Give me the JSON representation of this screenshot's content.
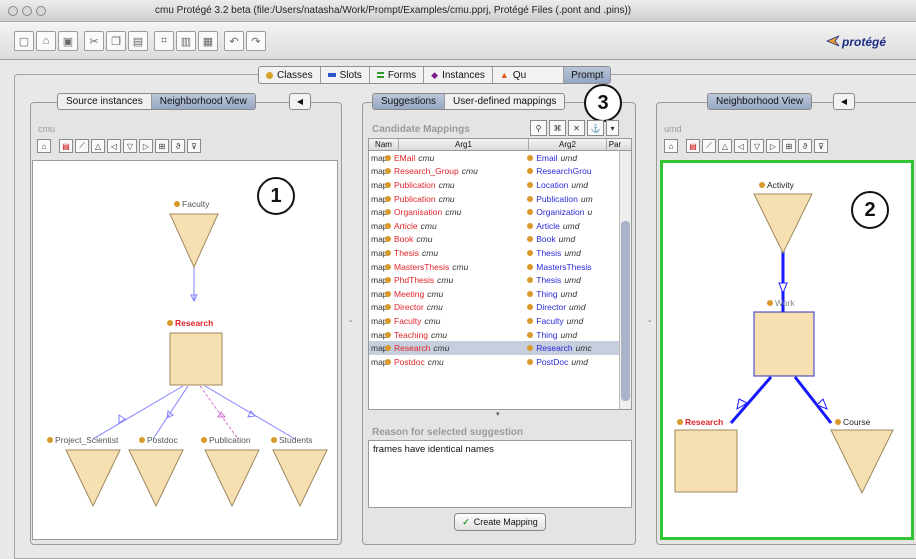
{
  "window": {
    "title": "cmu  Protégé 3.2 beta   (file:/Users/natasha/Work/Prompt/Examples/cmu.pprj, Protégé Files (.pont and .pins))"
  },
  "toolbar": {
    "logo": "protégé"
  },
  "main_tabs": [
    {
      "label": "Classes",
      "color": "#d9a22a"
    },
    {
      "label": "Slots",
      "color": "#2b55c8"
    },
    {
      "label": "Forms",
      "color": "#2e9a2e"
    },
    {
      "label": "Instances",
      "color": "#7a1e88"
    },
    {
      "label": "Qu",
      "color": "#e05a1a"
    },
    {
      "label": "Prompt",
      "color": ""
    }
  ],
  "left": {
    "tabs": [
      "Source instances",
      "Neighborhood View"
    ],
    "title": "cmu",
    "callout": "1",
    "nodes": {
      "root": "Faculty",
      "center": "Research",
      "children": [
        "Project_Scientist",
        "Postdoc",
        "Publication",
        "Students"
      ]
    }
  },
  "middle": {
    "tabs": [
      "Suggestions",
      "User-defined mappings"
    ],
    "callout": "3",
    "title": "Candidate Mappings",
    "columns": [
      "Nam",
      "Arg1",
      "Arg2",
      "Par"
    ],
    "rows": [
      {
        "a": "map",
        "s": "EMail",
        "so": "cmu",
        "t": "Email",
        "to": "umd"
      },
      {
        "a": "map",
        "s": "Research_Group",
        "so": "cmu",
        "t": "ResearchGrou",
        "to": ""
      },
      {
        "a": "map",
        "s": "Publication",
        "so": "cmu",
        "t": "Location",
        "to": "umd"
      },
      {
        "a": "map",
        "s": "Publication",
        "so": "cmu",
        "t": "Publication",
        "to": "um"
      },
      {
        "a": "map",
        "s": "Organisation",
        "so": "cmu",
        "t": "Organization",
        "to": "u"
      },
      {
        "a": "map",
        "s": "Article",
        "so": "cmu",
        "t": "Article",
        "to": "umd"
      },
      {
        "a": "map",
        "s": "Book",
        "so": "cmu",
        "t": "Book",
        "to": "umd"
      },
      {
        "a": "map",
        "s": "Thesis",
        "so": "cmu",
        "t": "Thesis",
        "to": "umd"
      },
      {
        "a": "map",
        "s": "MastersThesis",
        "so": "cmu",
        "t": "MastersThesis",
        "to": ""
      },
      {
        "a": "map",
        "s": "PhdThesis",
        "so": "cmu",
        "t": "Thesis",
        "to": "umd"
      },
      {
        "a": "map",
        "s": "Meeting",
        "so": "cmu",
        "t": "Thing",
        "to": "umd"
      },
      {
        "a": "map",
        "s": "Director",
        "so": "cmu",
        "t": "Director",
        "to": "umd"
      },
      {
        "a": "map",
        "s": "Faculty",
        "so": "cmu",
        "t": "Faculty",
        "to": "umd"
      },
      {
        "a": "map",
        "s": "Teaching",
        "so": "cmu",
        "t": "Thing",
        "to": "umd"
      },
      {
        "a": "map",
        "s": "Research",
        "so": "cmu",
        "t": "Research",
        "to": "umc"
      },
      {
        "a": "map",
        "s": "Postdoc",
        "so": "cmu",
        "t": "PostDoc",
        "to": "umd"
      }
    ],
    "reason_title": "Reason for selected suggestion",
    "reason_text": "frames have identical names",
    "create_button": "Create Mapping"
  },
  "right": {
    "tab": "Neighborhood View",
    "title": "umd",
    "callout": "2",
    "nodes": {
      "root": "Activity",
      "center": "Work",
      "children": [
        "Research",
        "Course"
      ]
    }
  }
}
